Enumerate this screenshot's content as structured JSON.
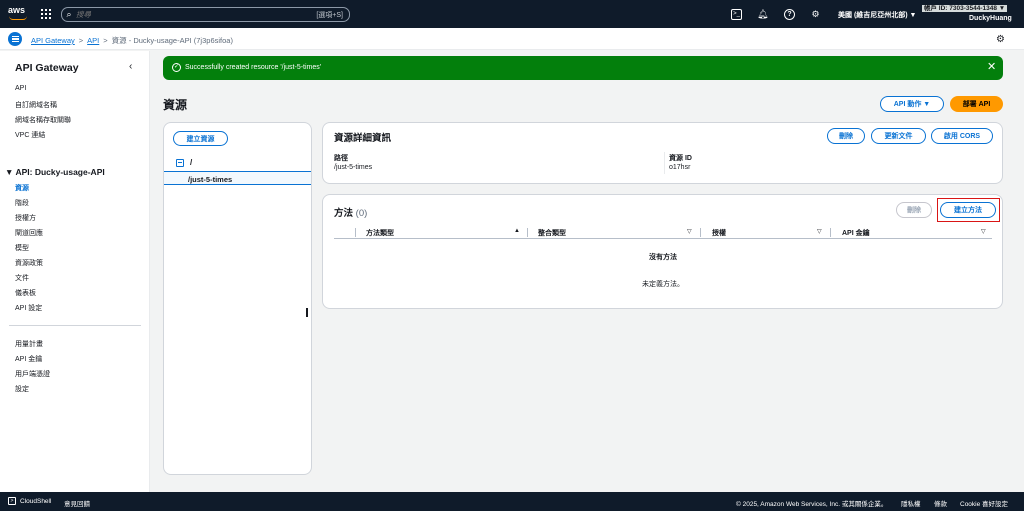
{
  "topnav": {
    "logo": "aws",
    "search_placeholder": "搜尋",
    "search_shortcut": "[選項+S]",
    "region": "美國 (維吉尼亞州北部) ▼",
    "account_label": "帳戶 ID: 7303-3544-1348 ▼",
    "user": "DuckyHuang",
    "icons": [
      "cloudshell-icon",
      "bell-icon",
      "help-icon",
      "gear-icon"
    ]
  },
  "breadcrumb": {
    "items": [
      "API Gateway",
      "API",
      "資源 - Ducky-usage-API (7j3p6sifoa)"
    ]
  },
  "sidebar": {
    "title": "API Gateway",
    "links_top": [
      "API",
      "自訂網域名稱",
      "網域名稱存取關聯",
      "VPC 連結"
    ],
    "api_section": "▼ API: Ducky-usage-API",
    "api_links": [
      "資源",
      "階段",
      "授權方",
      "閘道回應",
      "模型",
      "資源政策",
      "文件",
      "儀表板",
      "API 設定"
    ],
    "links_bottom": [
      "用量計畫",
      "API 金鑰",
      "用戶端憑證",
      "設定"
    ]
  },
  "flash": {
    "message": "Successfully created resource '/just-5-times'",
    "color": "#037f0c"
  },
  "main": {
    "title": "資源",
    "api_actions": "API 動作 ▼",
    "deploy": "部署 API",
    "create_resource": "建立資源",
    "tree_root": "/",
    "tree_selected": "/just-5-times",
    "details": {
      "title": "資源詳細資訊",
      "delete": "刪除",
      "update_docs": "更新文件",
      "enable_cors": "啟用 CORS",
      "path_label": "路徑",
      "path_value": "/just-5-times",
      "resource_id_label": "資源 ID",
      "resource_id_value": "o17hsr"
    },
    "methods": {
      "title": "方法",
      "count": "(0)",
      "delete": "刪除",
      "create": "建立方法",
      "columns": [
        "方法類型",
        "整合類型",
        "授權",
        "API 金鑰"
      ],
      "empty_title": "沒有方法",
      "empty_desc": "未定義方法。"
    }
  },
  "footer": {
    "cloudshell": "CloudShell",
    "feedback": "意見回饋",
    "copyright": "© 2025, Amazon Web Services, Inc. 或其關係企業。",
    "privacy": "隱私權",
    "terms": "條款",
    "cookie": "Cookie 喜好設定"
  }
}
